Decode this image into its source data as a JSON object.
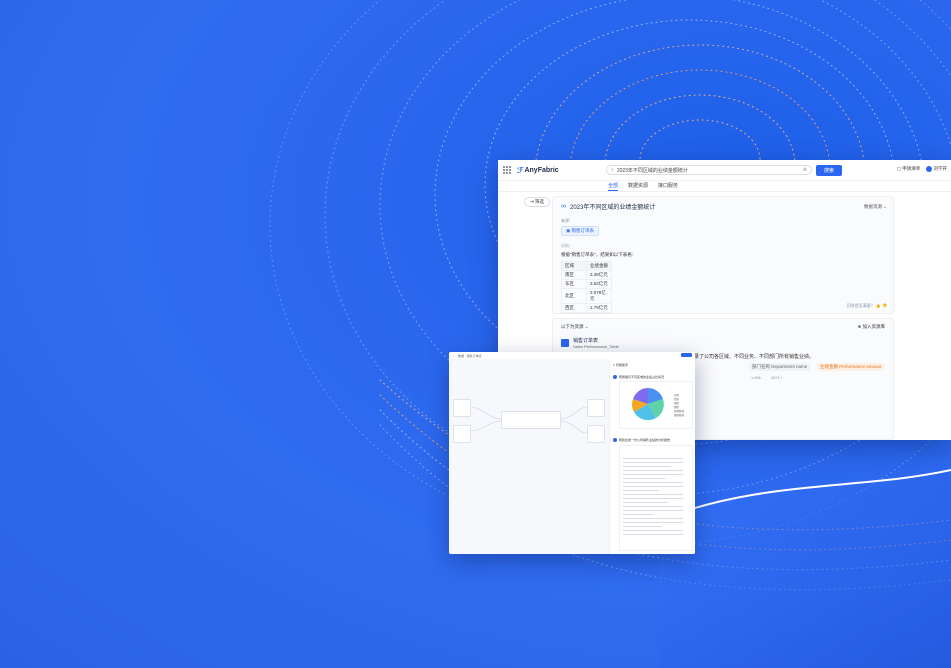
{
  "app": {
    "brand": "AnyFabric"
  },
  "search": {
    "value": "2023年不同区域的业绩金额统计",
    "button": "搜索"
  },
  "topbar_right": {
    "item1": "申请清单",
    "user": "刘学开"
  },
  "tabs": [
    "全部",
    "数据资源",
    "接口服务"
  ],
  "filter_label": "筛选",
  "answer": {
    "title": "2023年不同区域的业绩金额统计",
    "category_select": "数据资源",
    "source_label": "来源：",
    "source_chip": "销售订单表",
    "analysis_label": "分析：",
    "sentence": "根据\"销售订单表\"，结果如以下表格：",
    "table_headers": [
      "区域",
      "业绩金额"
    ],
    "table_rows": [
      [
        "南区",
        "3.38亿元"
      ],
      [
        "东区",
        "3.52亿元"
      ],
      [
        "北区",
        "3.078亿元"
      ],
      [
        "西区",
        "1.79亿元"
      ]
    ],
    "feedback": "回答是否满意？"
  },
  "result": {
    "heading": "以下为资源",
    "add": "加入资源库",
    "asset_name": "销售订单表",
    "asset_en": "Sales Performance_Table",
    "desc": "本表记录了公司各区域、不同业务、不同部门所有销售业绩。",
    "desc_highlight": "业绩",
    "tag1": "部门名称 Department name",
    "tag2": "业绩金额 Performance amount",
    "meta1": "1.89k",
    "meta2": "3871+"
  },
  "secondary": {
    "toolbar_title": "数据 · 销售订单表",
    "panel_title": "智能助手",
    "q1": "帮我展示不同区域的业绩占比情况",
    "q2": "帮我生成一份公司销售业绩的分析报告",
    "legend": [
      "东区",
      "北区",
      "南区",
      "西区",
      "其他区域",
      "国外区域"
    ]
  },
  "colors": {
    "accent": "#2b66f0",
    "highlight": "#e8751a"
  }
}
